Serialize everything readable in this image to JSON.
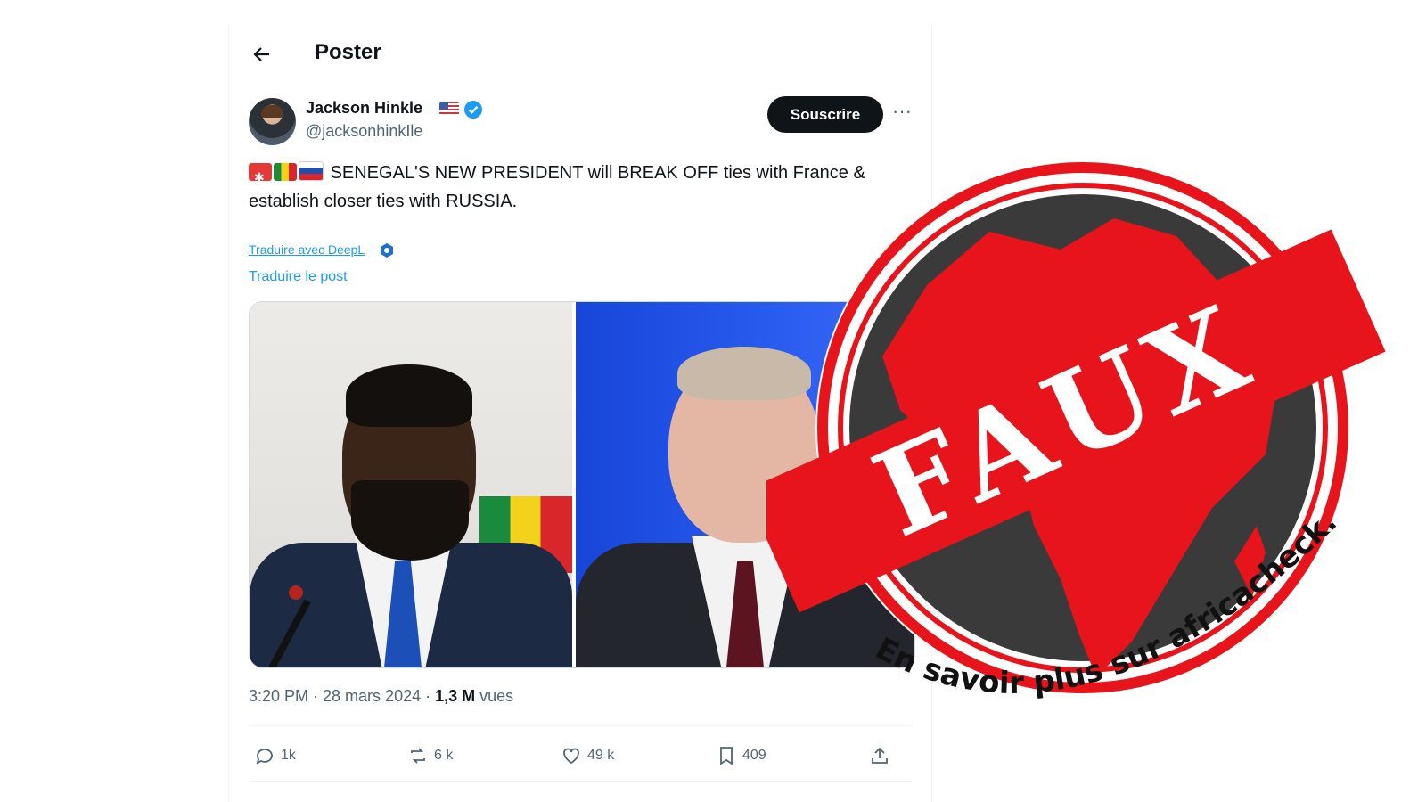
{
  "header": {
    "title": "Poster"
  },
  "author": {
    "name": "Jackson Hinkle",
    "handle": "@jacksonhinkIle",
    "flag_icon": "us-flag-icon",
    "verified_icon": "verified-badge-icon"
  },
  "subscribe_label": "Souscrire",
  "more_label": "···",
  "tweet": {
    "emojis": [
      "siren-emoji",
      "senegal-flag-emoji",
      "russia-flag-emoji"
    ],
    "text": "SENEGAL'S NEW PRESIDENT will BREAK OFF ties with France & establish closer ties with RUSSIA."
  },
  "deepl_label": "Traduire avec DeepL",
  "translate_label": "Traduire le post",
  "meta": {
    "time": "3:20 PM · 28 mars 2024 · ",
    "views_count": "1,3 M",
    "views_label": " vues"
  },
  "actions": {
    "replies": "1k",
    "reposts": "6 k",
    "likes": "49 k",
    "bookmarks": "409"
  },
  "stamp": {
    "label": "FAUX",
    "caption": "En savoir plus sur africacheck.org/fr",
    "colors": {
      "red": "#e8141b",
      "dark": "#3a3a3a"
    }
  }
}
